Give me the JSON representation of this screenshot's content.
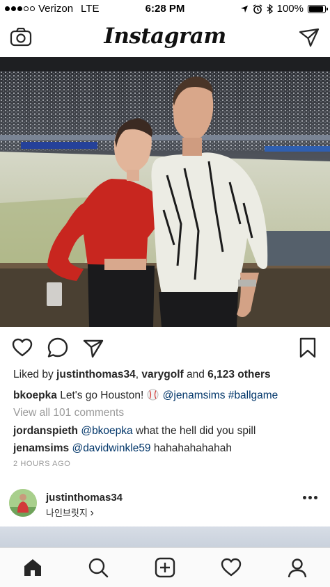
{
  "status_bar": {
    "carrier": "Verizon",
    "network": "LTE",
    "time": "6:28 PM",
    "battery": "100%",
    "battery_level": 1.0
  },
  "header": {
    "logo": "Instagram",
    "camera_icon": "camera-icon",
    "direct_icon": "paper-plane-icon"
  },
  "post": {
    "photo_icon": "photo-couple-stadium",
    "likes_prefix": "Liked by ",
    "liker_1": "justinthomas34",
    "liker_sep": ", ",
    "liker_2": "varygolf",
    "likes_and": " and ",
    "likes_count": "6,123 others",
    "caption": {
      "username": "bkoepka",
      "text": " Let's go Houston! ",
      "emoji_icon": "baseball-icon",
      "mention": "@jenamsims",
      "hashtag": "#ballgame"
    },
    "view_comments": "View all 101 comments",
    "comments": [
      {
        "username": "jordanspieth",
        "mention": "@bkoepka",
        "text": " what the hell did you spill"
      },
      {
        "username": "jenamsims",
        "mention": "@davidwinkle59",
        "text": " hahahahahahah"
      }
    ],
    "time_ago": "2 HOURS AGO"
  },
  "suggested": {
    "username": "justinthomas34",
    "location": "나인브릿지",
    "location_chevron": "›"
  },
  "tab_bar": [
    "home-icon",
    "search-icon",
    "add-icon",
    "heart-icon",
    "profile-icon"
  ],
  "colors": {
    "link": "#003569",
    "muted": "#999999",
    "text": "#262626"
  }
}
